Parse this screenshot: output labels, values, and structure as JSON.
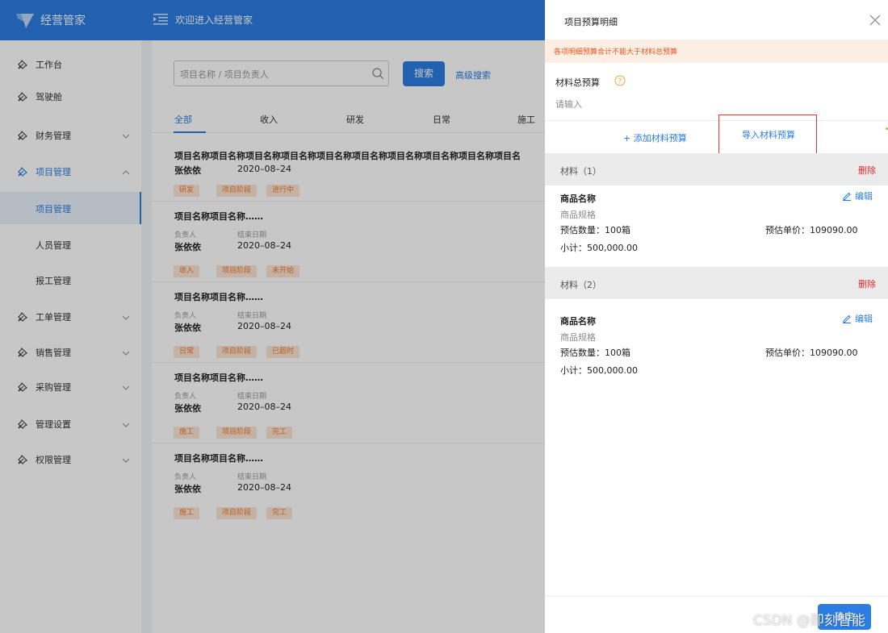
{
  "app": {
    "logo_text": "经营管家",
    "welcome": "欢迎进入经营管家"
  },
  "sidebar": {
    "items": [
      {
        "label": "工作台",
        "icon": "pin-icon",
        "has_chevron": false
      },
      {
        "label": "驾驶舱",
        "icon": "pin-icon",
        "has_chevron": false
      },
      {
        "label": "财务管理",
        "icon": "pin-icon",
        "has_chevron": true
      },
      {
        "label": "项目管理",
        "icon": "pin-icon",
        "has_chevron": true,
        "expanded": true
      },
      {
        "label": "工单管理",
        "icon": "pin-icon",
        "has_chevron": true
      },
      {
        "label": "销售管理",
        "icon": "pin-icon",
        "has_chevron": true
      },
      {
        "label": "采购管理",
        "icon": "pin-icon",
        "has_chevron": true
      },
      {
        "label": "管理设置",
        "icon": "pin-icon",
        "has_chevron": true
      },
      {
        "label": "权限管理",
        "icon": "pin-icon",
        "has_chevron": true
      }
    ],
    "subitems": [
      {
        "label": "项目管理",
        "active": true
      },
      {
        "label": "人员管理",
        "active": false
      },
      {
        "label": "报工管理",
        "active": false
      }
    ]
  },
  "main": {
    "search": {
      "placeholder": "项目名称 / 项目负责人",
      "button": "搜索",
      "advanced": "高级搜索"
    },
    "tabs": [
      "全部",
      "收入",
      "研发",
      "日常",
      "施工"
    ],
    "owner_label": "负责人",
    "end_label": "结束日期",
    "projects": [
      {
        "name": "项目名称项目名称项目名称项目名称项目名称项目名称项目名称项目名称项目名称项目名",
        "owner": "张依依",
        "date": "2020–08–24",
        "tags": [
          "研发",
          "项目阶段",
          "进行中"
        ],
        "show_meta_labels": false
      },
      {
        "name": "项目名称项目名称……",
        "owner": "张依依",
        "date": "2020–08–24",
        "tags": [
          "收入",
          "项目阶段",
          "未开始"
        ],
        "show_meta_labels": true
      },
      {
        "name": "项目名称项目名称……",
        "owner": "张依依",
        "date": "2020–08–24",
        "tags": [
          "日常",
          "项目阶段",
          "已超时"
        ],
        "show_meta_labels": true
      },
      {
        "name": "项目名称项目名称……",
        "owner": "张依依",
        "date": "2020–08–24",
        "tags": [
          "施工",
          "项目阶段",
          "完工"
        ],
        "show_meta_labels": true
      },
      {
        "name": "项目名称项目名称……",
        "owner": "张依依",
        "date": "2020–08–24",
        "tags": [
          "施工",
          "项目阶段",
          "完工"
        ],
        "show_meta_labels": true
      }
    ]
  },
  "drawer": {
    "title": "项目预算明细",
    "warning": "各项明细预算合计不能大于材料总预算",
    "budget_label": "材料总预算",
    "budget_placeholder": "请输入",
    "add_link": "+ 添加材料预算",
    "import_link": "导入材料预算",
    "materials": [
      {
        "title": "材料（1）",
        "delete": "删除",
        "edit": "编辑",
        "goods_name": "商品名称",
        "goods_spec": "商品规格",
        "qty": "预估数量：100箱",
        "price": "预估单价：109090.00",
        "subtotal": "小计：500,000.00"
      },
      {
        "title": "材料（2）",
        "delete": "删除",
        "edit": "编辑",
        "goods_name": "商品名称",
        "goods_spec": "商品规格",
        "qty": "预估数量：100箱",
        "price": "预估单价：109090.00",
        "subtotal": "小计：500,000.00"
      }
    ],
    "confirm": "确定"
  },
  "watermark": "CSDN @即刻智能",
  "colors": {
    "primary": "#2b7de1",
    "danger": "#e32b2b",
    "warning": "#e8551e",
    "tag_bg": "#fbe4d4",
    "tag_text": "#ee7a2e"
  }
}
